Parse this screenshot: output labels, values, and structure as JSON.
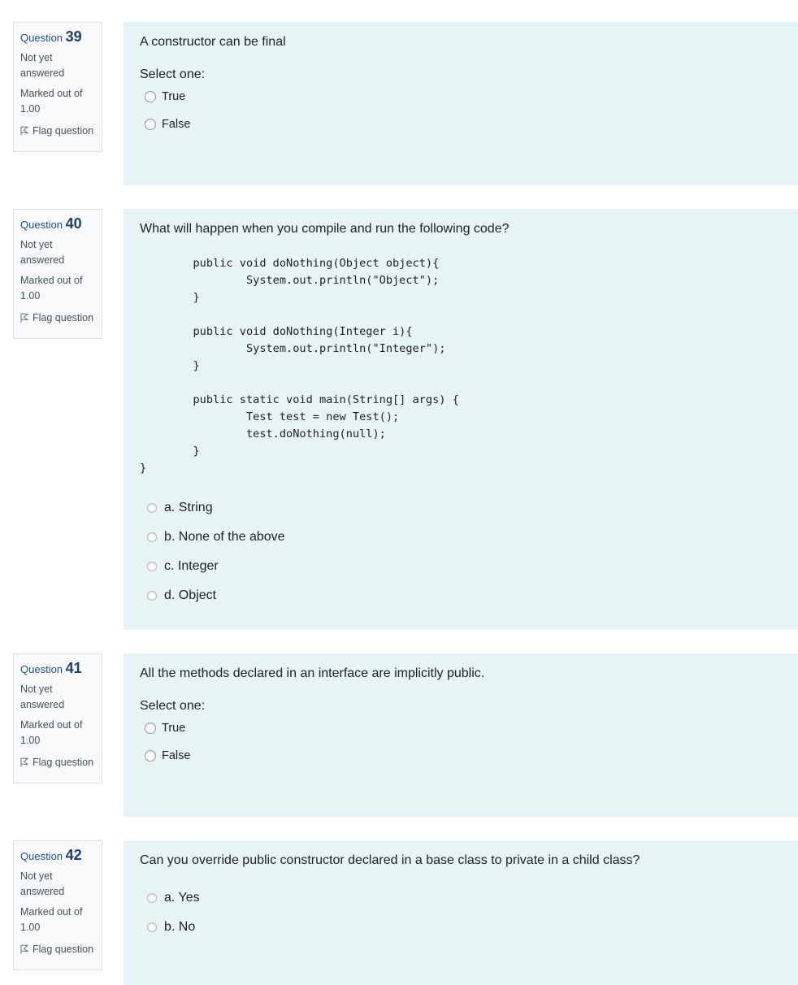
{
  "questions": [
    {
      "label": "Question",
      "number": "39",
      "state": "Not yet answered",
      "grade_line1": "Marked out of",
      "grade_line2": "1.00",
      "flag_label": "Flag question",
      "text": "A constructor can be final",
      "prompt": "Select one:",
      "options": [
        "True",
        "False"
      ]
    },
    {
      "label": "Question",
      "number": "40",
      "state": "Not yet answered",
      "grade_line1": "Marked out of",
      "grade_line2": "1.00",
      "flag_label": "Flag question",
      "text": "What will happen when you compile and run the following code?",
      "code": "        public void doNothing(Object object){\n                System.out.println(\"Object\");\n        }\n\n        public void doNothing(Integer i){\n                System.out.println(\"Integer\");\n        }\n\n        public static void main(String[] args) {\n                Test test = new Test();\n                test.doNothing(null);\n        }\n}",
      "options": [
        "a. String",
        "b. None of the above",
        "c. Integer",
        "d. Object"
      ]
    },
    {
      "label": "Question",
      "number": "41",
      "state": "Not yet answered",
      "grade_line1": "Marked out of",
      "grade_line2": "1.00",
      "flag_label": "Flag question",
      "text": "All the methods declared in an interface are implicitly public.",
      "prompt": "Select one:",
      "options": [
        "True",
        "False"
      ]
    },
    {
      "label": "Question",
      "number": "42",
      "state": "Not yet answered",
      "grade_line1": "Marked out of",
      "grade_line2": "1.00",
      "flag_label": "Flag question",
      "text": "Can you override public constructor declared in a base class to private in a child class?",
      "options": [
        "a. Yes",
        "b. No"
      ]
    }
  ]
}
